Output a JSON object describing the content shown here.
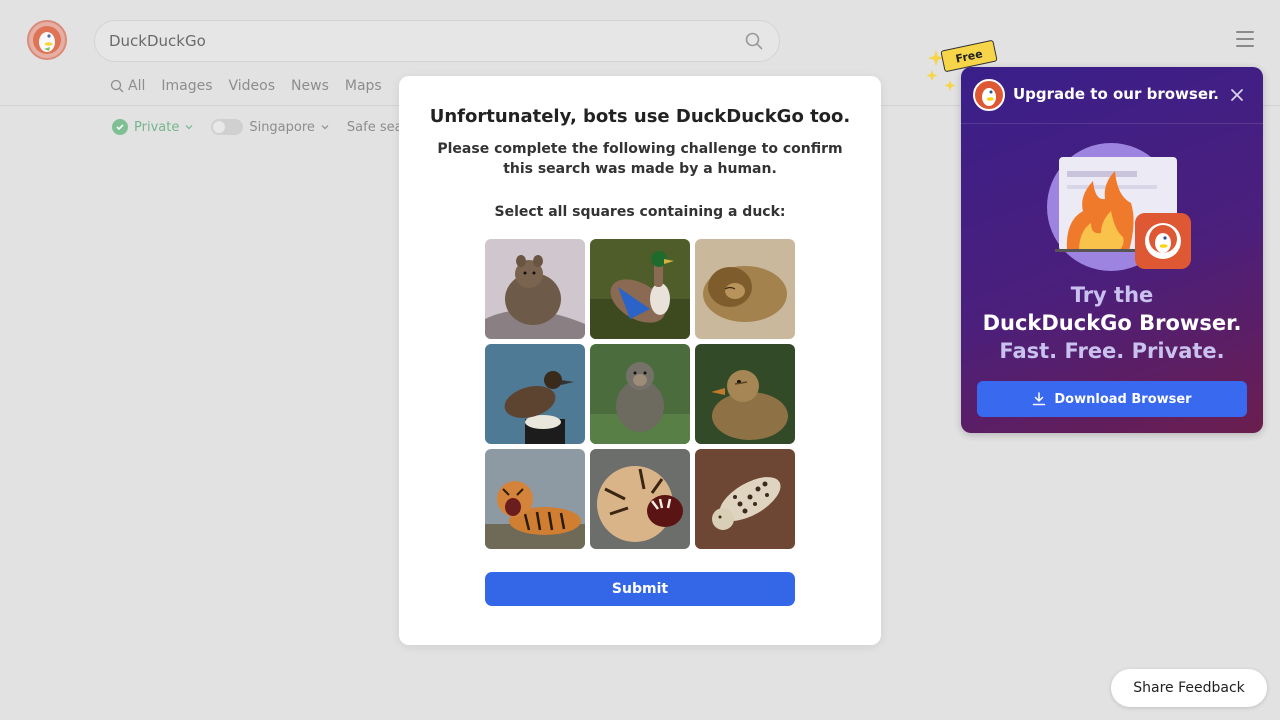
{
  "header": {
    "search_value": "DuckDuckGo",
    "icons": {
      "logo": "duckduckgo-logo",
      "search": "search-icon",
      "menu": "hamburger-menu-icon"
    }
  },
  "tabs": [
    {
      "label": "All",
      "icon": "search-icon",
      "active": true
    },
    {
      "label": "Images"
    },
    {
      "label": "Videos"
    },
    {
      "label": "News"
    },
    {
      "label": "Maps"
    }
  ],
  "filters": {
    "private_label": "Private",
    "region_label": "Singapore",
    "safe_search_label": "Safe search"
  },
  "captcha": {
    "title": "Unfortunately, bots use DuckDuckGo too.",
    "subtitle": "Please complete the following challenge to confirm this search was made by a human.",
    "instruction": "Select all squares containing a duck:",
    "tiles": [
      {
        "subject": "rabbit"
      },
      {
        "subject": "mallard duck"
      },
      {
        "subject": "sleeping lion"
      },
      {
        "subject": "duck on post"
      },
      {
        "subject": "monkey"
      },
      {
        "subject": "duck"
      },
      {
        "subject": "yawning tiger"
      },
      {
        "subject": "roaring tiger"
      },
      {
        "subject": "leopard"
      }
    ],
    "submit_label": "Submit"
  },
  "promo": {
    "badge": "Free",
    "title": "Upgrade to our browser.",
    "line1": "Try the",
    "line2": "DuckDuckGo Browser.",
    "line3": "Fast. Free. Private.",
    "download_label": "Download Browser"
  },
  "feedback_label": "Share Feedback",
  "colors": {
    "accent": "#3467e8",
    "promo_bg": "#3a1f8a",
    "private_green": "#76b58d",
    "badge_yellow": "#f7d549"
  }
}
